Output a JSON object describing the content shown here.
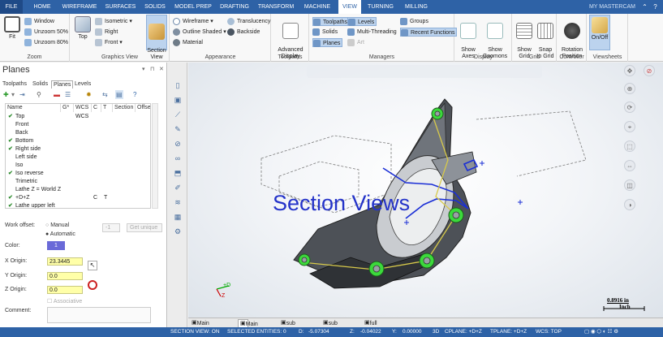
{
  "tabs": [
    "FILE",
    "HOME",
    "WIREFRAME",
    "SURFACES",
    "SOLIDS",
    "MODEL PREP",
    "DRAFTING",
    "TRANSFORM",
    "MACHINE",
    "VIEW",
    "TURNING",
    "MILLING"
  ],
  "active_tab": "VIEW",
  "account": "MY MASTERCAM",
  "ribbon": {
    "zoom": {
      "label": "Zoom",
      "fit": "Fit",
      "window": "Window",
      "unzoom50": "Unzoom 50%",
      "unzoom80": "Unzoom 80%"
    },
    "graphics_view": {
      "label": "Graphics View",
      "top": "Top",
      "isometric": "Isometric",
      "right": "Right",
      "front": "Front",
      "section_view": "Section\nView"
    },
    "appearance": {
      "label": "Appearance",
      "wireframe": "Wireframe",
      "outline_shaded": "Outline Shaded",
      "material": "Material",
      "translucency": "Translucency",
      "backside": "Backside"
    },
    "toolpaths": {
      "label": "Toolpaths",
      "advanced_display": "Advanced\nDisplay"
    },
    "managers": {
      "label": "Managers",
      "toolpaths": "Toolpaths",
      "solids": "Solids",
      "planes": "Planes",
      "levels": "Levels",
      "multi_threading": "Multi-Threading",
      "art": "Art",
      "groups": "Groups",
      "recent_functions": "Recent Functions"
    },
    "display": {
      "label": "Display",
      "show_axes": "Show\nAxes",
      "show_gnomons": "Show\nGnomons"
    },
    "grid": {
      "label": "Grid",
      "show_grid": "Show\nGrid",
      "snap_to_grid": "Snap\nto Grid"
    },
    "controller": {
      "label": "Controller",
      "rotation_position": "Rotation\nPosition"
    },
    "viewsheets": {
      "label": "Viewsheets",
      "on_off": "On/Off"
    }
  },
  "panel": {
    "title": "Planes",
    "tabs": [
      "Toolpaths",
      "Solids",
      "Planes",
      "Levels"
    ],
    "active_tab": "Planes",
    "columns": [
      "Name",
      "G*",
      "WCS",
      "C",
      "T",
      "Section",
      "Offse"
    ],
    "rows": [
      {
        "check": true,
        "name": "Top",
        "wcs": "WCS",
        "c": "",
        "t": ""
      },
      {
        "check": false,
        "name": "Front",
        "wcs": "",
        "c": "",
        "t": ""
      },
      {
        "check": false,
        "name": "Back",
        "wcs": "",
        "c": "",
        "t": ""
      },
      {
        "check": true,
        "name": "Bottom",
        "wcs": "",
        "c": "",
        "t": ""
      },
      {
        "check": true,
        "name": "Right side",
        "wcs": "",
        "c": "",
        "t": ""
      },
      {
        "check": false,
        "name": "Left side",
        "wcs": "",
        "c": "",
        "t": ""
      },
      {
        "check": false,
        "name": "Iso",
        "wcs": "",
        "c": "",
        "t": ""
      },
      {
        "check": true,
        "name": "Iso reverse",
        "wcs": "",
        "c": "",
        "t": ""
      },
      {
        "check": false,
        "name": "Trimetric",
        "wcs": "",
        "c": "",
        "t": ""
      },
      {
        "check": false,
        "name": "Lathe Z = World Z",
        "wcs": "",
        "c": "",
        "t": ""
      },
      {
        "check": true,
        "name": "+D+Z",
        "wcs": "",
        "c": "C",
        "t": "T"
      },
      {
        "check": true,
        "name": "Lathe upper left",
        "wcs": "",
        "c": "",
        "t": ""
      }
    ],
    "work_offset_label": "Work offset:",
    "manual": "Manual",
    "automatic": "Automatic",
    "offset_value": "-1",
    "get_unique": "Get unique",
    "color_label": "Color:",
    "color_value": "1",
    "x_origin_label": "X Origin:",
    "x_origin": "23.3445",
    "y_origin_label": "Y Origin:",
    "y_origin": "0.0",
    "z_origin_label": "Z Origin:",
    "z_origin": "0.0",
    "associative": "Associative",
    "comment_label": "Comment:"
  },
  "viewport": {
    "caption": "Section Views",
    "scale_value": "0.8916 in",
    "scale_unit": "Inch",
    "gnomon_d": "+D",
    "gnomon_z": "Z"
  },
  "sheet_tabs": [
    "Main turning",
    "Main Milling",
    "sub turning",
    "sub milling",
    "full machine"
  ],
  "active_sheet": "Main Milling",
  "status": {
    "section_view": "SECTION VIEW: ON",
    "selected": "SELECTED ENTITIES: 0",
    "d": "D:",
    "d_val": "-5.07304",
    "z": "Z:",
    "z_val": "-0.04022",
    "y": "Y:",
    "y_val": "0.00000",
    "mode": "3D",
    "cplane": "CPLANE: +D+Z",
    "tplane": "TPLANE: +D+Z",
    "wcs": "WCS: TOP"
  },
  "colors": {
    "brand": "#2e62a6",
    "caption": "#2433c9",
    "highlight_green": "#2ad22a",
    "outline_blue": "#1b2fd6"
  }
}
